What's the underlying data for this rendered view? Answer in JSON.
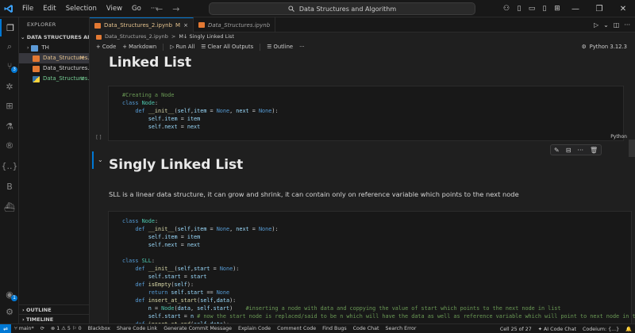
{
  "menu": [
    "File",
    "Edit",
    "Selection",
    "View",
    "Go"
  ],
  "search": {
    "text": "Data Structures and Algorithm"
  },
  "sidebar": {
    "title": "EXPLORER",
    "folder": "DATA STRUCTURES AND A...",
    "items": [
      {
        "label": "TH",
        "status": "",
        "color": "#cccccc",
        "icon": "folder"
      },
      {
        "label": "Data_Structures...",
        "status": "M",
        "color": "#e2c08d",
        "icon": "notebook"
      },
      {
        "label": "Data_Structures.ipy...",
        "status": "",
        "color": "#cccccc",
        "icon": "notebook"
      },
      {
        "label": "Data_Structures...",
        "status": "U",
        "color": "#73c991",
        "icon": "python"
      }
    ],
    "outline": "OUTLINE",
    "timeline": "TIMELINE"
  },
  "tabs": [
    {
      "label": "Data_Structures_2.ipynb",
      "modified": "M",
      "close": "×"
    },
    {
      "label": "Data_Structures.ipynb"
    }
  ],
  "breadcrumb": {
    "file": "Data_Structures_2.ipynb",
    "sep": ">",
    "section": "M↓ Singly Linked List"
  },
  "toolbar": {
    "code": "+ Code",
    "markdown": "+ Markdown",
    "run_all": "Run All",
    "clear": "Clear All Outputs",
    "outline": "Outline",
    "kernel": "Python 3.12.3"
  },
  "cells": {
    "h1_linked": "Linked List",
    "h1_singly": "Singly Linked List",
    "paragraph": "SLL is a linear data structure, it can grow and shrink, it can contain only on reference variable which points to the next node",
    "lang": "Python",
    "exec": "[ ]",
    "code1": [
      "#Creating a Node",
      "class Node:",
      "def __init__(self,item = None, next = None):",
      "self.item = item",
      "self.next = next"
    ],
    "code2": [
      "class Node:",
      "def __init__(self,item = None, next = None):",
      "self.item = item",
      "self.next = next",
      "",
      "class SLL:",
      "def __init__(self,start = None):",
      "self.start = start",
      "def isEmpty(self):",
      "return self.start == None",
      "def insert_at_start(self,data):",
      "n = Node(data, self.start)",
      "#inserting a node with data and coppying the value of start which points to the next node in list",
      "self.start = n",
      "# now the start node is replaced/said to be n which will have the data as well as reference variable which will point to next node in the",
      "def insert_at_end(self,data):"
    ]
  },
  "status": {
    "branch": "main*",
    "sync": "⟳",
    "errors": "1",
    "warnings": "5",
    "info": "0",
    "items": [
      "Blackbox",
      "Share Code Link",
      "Generate Commit Message",
      "Explain Code",
      "Comment Code",
      "Find Bugs",
      "Code Chat",
      "Search Error"
    ],
    "cell": "Cell 25 of 27",
    "ai": "AI Code Chat",
    "codeium": "Codeium: {...}"
  }
}
